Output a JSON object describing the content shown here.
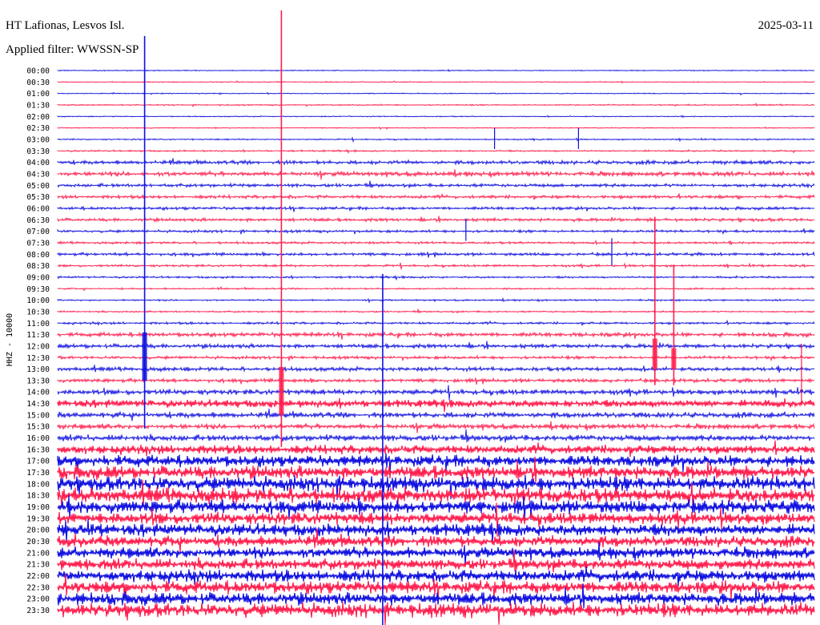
{
  "header": {
    "station": "HT Lafionas, Lesvos Isl.",
    "filter": "Applied filter: WWSSN-SP",
    "date": "2025-03-11"
  },
  "chart_data": {
    "type": "line",
    "title": "HT Lafionas, Lesvos Isl.",
    "subtitle": "Applied filter: WWSSN-SP",
    "ylabel": "HHZ - 10000",
    "colors": {
      "odd": "#1010e0",
      "even": "#ff1e4e"
    },
    "rows": [
      "00:00",
      "00:30",
      "01:00",
      "01:30",
      "02:00",
      "02:30",
      "03:00",
      "03:30",
      "04:00",
      "04:30",
      "05:00",
      "05:30",
      "06:00",
      "06:30",
      "07:00",
      "07:30",
      "08:00",
      "08:30",
      "09:00",
      "09:30",
      "10:00",
      "10:30",
      "11:00",
      "11:30",
      "12:00",
      "12:30",
      "13:00",
      "13:30",
      "14:00",
      "14:30",
      "15:00",
      "15:30",
      "16:00",
      "16:30",
      "17:00",
      "17:30",
      "18:00",
      "18:30",
      "19:00",
      "19:30",
      "20:00",
      "20:30",
      "21:00",
      "21:30",
      "22:00",
      "22:30",
      "23:00",
      "23:30"
    ],
    "ticks": [
      "00:00",
      "00:30",
      "01:00",
      "01:30",
      "02:00",
      "02:30",
      "03:00",
      "03:30",
      "04:00",
      "04:30",
      "05:00",
      "05:30",
      "06:00",
      "06:30",
      "07:00",
      "07:30",
      "08:00",
      "08:30",
      "09:00",
      "09:30",
      "10:00",
      "10:30",
      "11:00",
      "11:30",
      "12:00",
      "12:30",
      "13:00",
      "13:30",
      "14:00",
      "14:30",
      "15:00",
      "15:30",
      "16:00",
      "16:30",
      "17:00",
      "17:30",
      "18:00",
      "18:30",
      "19:00",
      "19:30",
      "20:00",
      "20:30",
      "21:00",
      "21:30",
      "22:00",
      "22:30",
      "23:00",
      "23:30"
    ],
    "noise_level": [
      0.3,
      0.3,
      0.3,
      0.4,
      0.3,
      0.3,
      0.4,
      0.5,
      1.2,
      1.4,
      1.0,
      1.0,
      0.9,
      1.0,
      0.8,
      0.7,
      0.9,
      0.7,
      0.6,
      0.5,
      0.5,
      0.5,
      0.7,
      1.3,
      1.3,
      0.9,
      1.2,
      1.1,
      1.6,
      2.2,
      1.8,
      1.6,
      1.9,
      2.6,
      3.4,
      4.0,
      4.4,
      4.4,
      4.0,
      3.6,
      3.6,
      3.4,
      3.2,
      3.2,
      3.6,
      3.8,
      3.8,
      4.2
    ],
    "spikes": [
      {
        "row": 0,
        "at": 0.115,
        "color": "odd",
        "up": 4,
        "down": 28
      },
      {
        "row": 27,
        "at": 0.115,
        "color": "odd",
        "up": 430,
        "down": 60
      },
      {
        "row": 0,
        "at": 0.296,
        "color": "even",
        "up": 4,
        "down": 60
      },
      {
        "row": 30,
        "at": 0.296,
        "color": "even",
        "up": 505,
        "down": 40
      },
      {
        "row": 18,
        "at": 0.43,
        "color": "odd",
        "up": 4,
        "down": 440
      },
      {
        "row": 6,
        "at": 0.578,
        "color": "odd",
        "up": 14,
        "down": 12
      },
      {
        "row": 6,
        "at": 0.689,
        "color": "odd",
        "up": 14,
        "down": 12
      },
      {
        "row": 14,
        "at": 0.54,
        "color": "odd",
        "up": 16,
        "down": 12
      },
      {
        "row": 16,
        "at": 0.733,
        "color": "odd",
        "up": 20,
        "down": 14
      },
      {
        "row": 26,
        "at": 0.79,
        "color": "even",
        "up": 190,
        "down": 20
      },
      {
        "row": 26,
        "at": 0.815,
        "color": "even",
        "up": 130,
        "down": 20
      },
      {
        "row": 28,
        "at": 0.984,
        "color": "even",
        "up": 60,
        "down": 16
      }
    ]
  }
}
